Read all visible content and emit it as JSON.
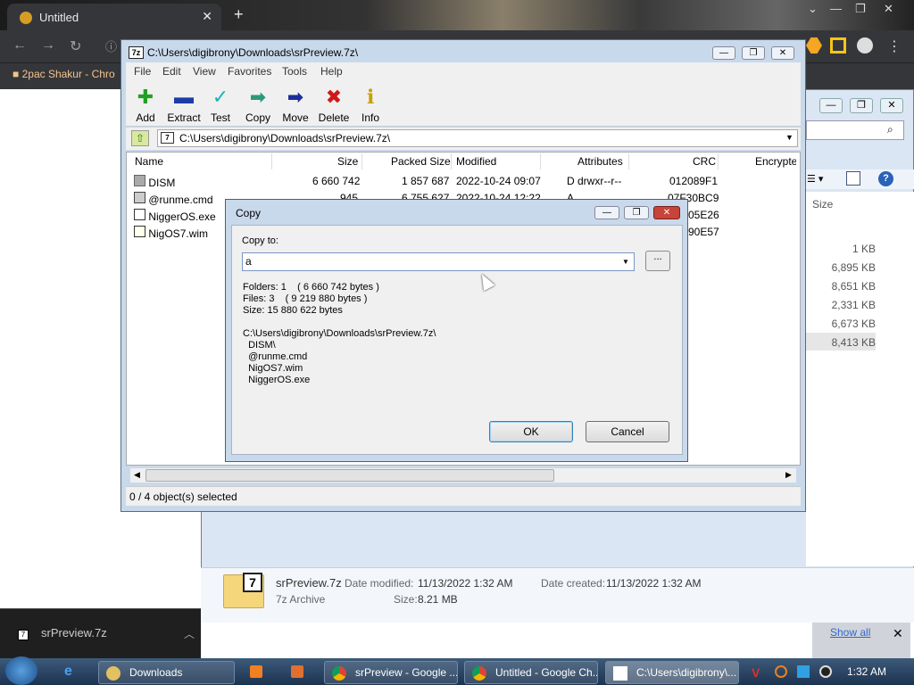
{
  "chrome": {
    "tab_title": "Untitled",
    "bookmark": "2pac Shakur - Chro",
    "download_file": "srPreview.7z",
    "show_all": "Show all"
  },
  "explorer": {
    "size_header": "Size",
    "sizes": [
      "1 KB",
      "6,895 KB",
      "8,651 KB",
      "2,331 KB",
      "6,673 KB",
      "8,413 KB"
    ],
    "filename": "srPreview.7z",
    "filetype": "7z Archive",
    "date_modified_label": "Date modified:",
    "date_modified": "11/13/2022 1:32 AM",
    "date_created_label": "Date created:",
    "date_created": "11/13/2022 1:32 AM",
    "size_label": "Size:",
    "size": "8.21 MB"
  },
  "sevenzip": {
    "title": "C:\\Users\\digibrony\\Downloads\\srPreview.7z\\",
    "menu": [
      "File",
      "Edit",
      "View",
      "Favorites",
      "Tools",
      "Help"
    ],
    "toolbar": [
      "Add",
      "Extract",
      "Test",
      "Copy",
      "Move",
      "Delete",
      "Info"
    ],
    "address": "C:\\Users\\digibrony\\Downloads\\srPreview.7z\\",
    "columns": [
      "Name",
      "Size",
      "Packed Size",
      "Modified",
      "Attributes",
      "CRC",
      "Encrypte"
    ],
    "rows": [
      {
        "name": "DISM",
        "size": "6 660 742",
        "packed": "1 857 687",
        "modified": "2022-10-24 09:07",
        "attr": "D drwxr--r--",
        "crc": "012089F1"
      },
      {
        "name": "@runme.cmd",
        "size": "945",
        "packed": "6 755 627",
        "modified": "2022-10-24 12:22",
        "attr": "A",
        "crc": "07F30BC9"
      },
      {
        "name": "NiggerOS.exe",
        "size": "",
        "packed": "",
        "modified": "",
        "attr": "",
        "crc": "05E26"
      },
      {
        "name": "NigOS7.wim",
        "size": "",
        "packed": "",
        "modified": "",
        "attr": "",
        "crc": "90E57"
      }
    ],
    "status": "0 / 4 object(s) selected"
  },
  "dialog": {
    "title": "Copy",
    "copy_to_label": "Copy to:",
    "copy_to_value": "a",
    "browse": "...",
    "info_lines": "Folders: 1    ( 6 660 742 bytes )\nFiles: 3    ( 9 219 880 bytes )\nSize: 15 880 622 bytes",
    "path_lines": "C:\\Users\\digibrony\\Downloads\\srPreview.7z\\\n  DISM\\\n  @runme.cmd\n  NigOS7.wim\n  NiggerOS.exe",
    "ok": "OK",
    "cancel": "Cancel"
  },
  "taskbar": {
    "items": [
      "Downloads",
      "srPreview - Google ...",
      "Untitled - Google Ch...",
      "C:\\Users\\digibrony\\..."
    ],
    "clock": "1:32 AM"
  },
  "colors": {
    "accent": "#3c7fb1",
    "taskbar": "#1c3350",
    "chrome_dark": "#35363a"
  }
}
